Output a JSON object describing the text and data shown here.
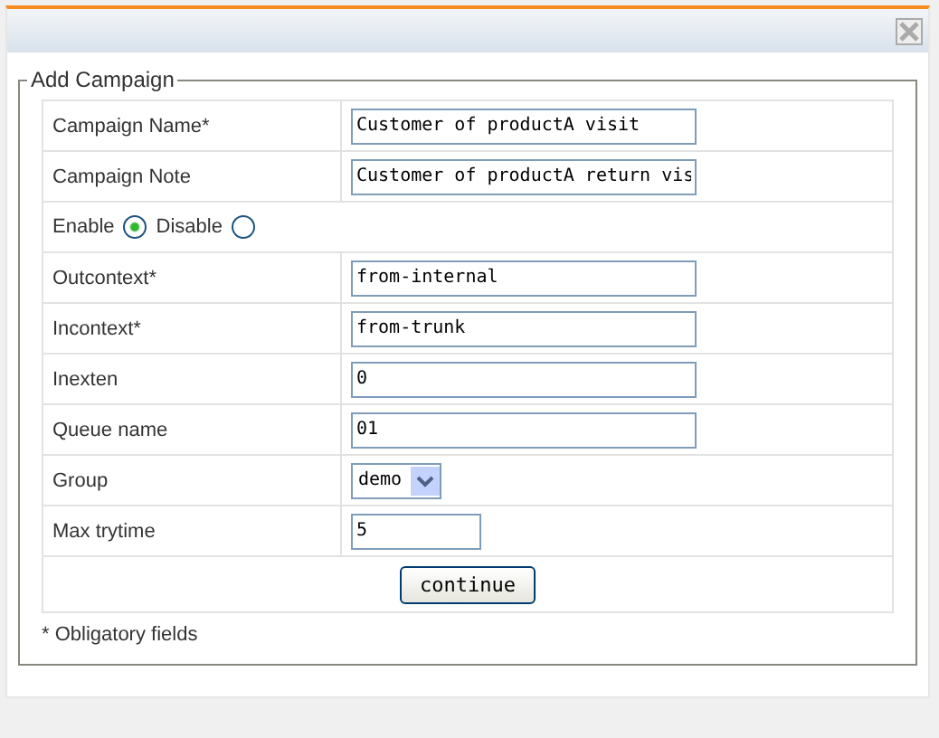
{
  "legend": "Add Campaign",
  "rows": [
    {
      "kind": "text",
      "label": "Campaign Name*",
      "value": "Customer of productA visit"
    },
    {
      "kind": "text",
      "label": "Campaign Note",
      "value": "Customer of productA return vis"
    },
    {
      "kind": "radio",
      "options": [
        {
          "label": "Enable",
          "selected": true
        },
        {
          "label": "Disable",
          "selected": false
        }
      ]
    },
    {
      "kind": "text",
      "label": "Outcontext*",
      "value": "from-internal"
    },
    {
      "kind": "text",
      "label": "Incontext*",
      "value": "from-trunk"
    },
    {
      "kind": "text",
      "label": "Inexten",
      "value": "0"
    },
    {
      "kind": "text",
      "label": "Queue name",
      "value": "01"
    },
    {
      "kind": "select",
      "label": "Group",
      "value": "demo"
    },
    {
      "kind": "short",
      "label": "Max trytime",
      "value": "5"
    }
  ],
  "button": "continue",
  "note": "* Obligatory fields"
}
